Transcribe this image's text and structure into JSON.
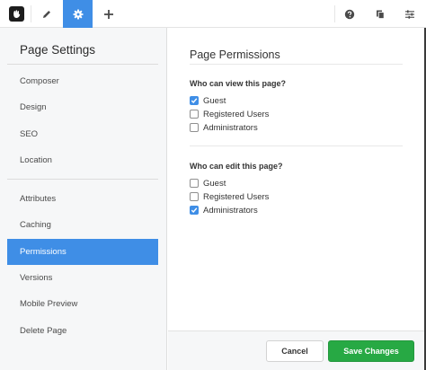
{
  "toolbar": {
    "icons": [
      "concrete-logo-icon",
      "pencil-icon",
      "gear-icon",
      "plus-icon",
      "help-icon",
      "pages-icon",
      "sliders-icon"
    ],
    "active_color": "#3f8ee6"
  },
  "sidebar": {
    "title": "Page Settings",
    "groups": [
      [
        "Composer",
        "Design",
        "SEO",
        "Location"
      ],
      [
        "Attributes",
        "Caching",
        "Permissions",
        "Versions",
        "Mobile Preview",
        "Delete Page"
      ]
    ],
    "active_item": "Permissions"
  },
  "main": {
    "title": "Page Permissions",
    "view_section": {
      "label": "Who can view this page?",
      "options": [
        {
          "label": "Guest",
          "checked": true
        },
        {
          "label": "Registered Users",
          "checked": false
        },
        {
          "label": "Administrators",
          "checked": false
        }
      ]
    },
    "edit_section": {
      "label": "Who can edit this page?",
      "options": [
        {
          "label": "Guest",
          "checked": false
        },
        {
          "label": "Registered Users",
          "checked": false
        },
        {
          "label": "Administrators",
          "checked": true
        }
      ]
    }
  },
  "footer": {
    "cancel_label": "Cancel",
    "save_label": "Save Changes",
    "save_color": "#27a944"
  }
}
